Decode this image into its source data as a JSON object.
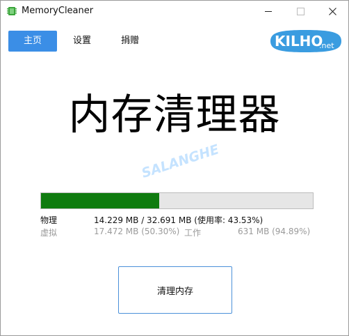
{
  "window": {
    "title": "MemoryCleaner"
  },
  "nav": {
    "tabs": [
      {
        "label": "主页"
      },
      {
        "label": "设置"
      },
      {
        "label": "捐赠"
      }
    ]
  },
  "logo": {
    "text": "KILHO",
    "suffix": ".net"
  },
  "main": {
    "heading": "内存清理器",
    "watermark": "SALANGHE",
    "usage_fraction": 0.4353,
    "physical": {
      "label": "物理",
      "value": "14.229 MB / 32.691 MB (使用率: 43.53%)"
    },
    "virtual": {
      "label": "虚拟",
      "value": "17.472 MB (50.30%)"
    },
    "working": {
      "label": "工作",
      "value": "631 MB (94.89%)"
    },
    "clean_button": "清理内存"
  },
  "colors": {
    "accent": "#3b8ee6",
    "progress": "#0f7b0f",
    "logo": "#3a9ce0"
  }
}
